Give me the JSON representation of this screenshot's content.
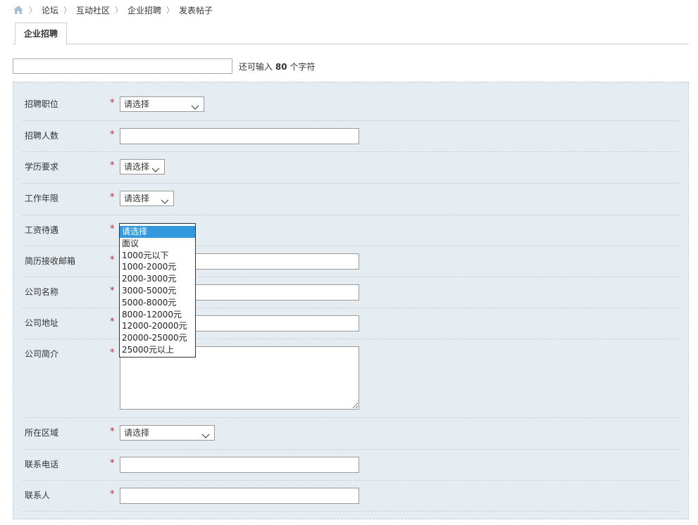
{
  "breadcrumb": {
    "items": [
      "论坛",
      "互动社区",
      "企业招聘",
      "发表帖子"
    ],
    "separator": "〉",
    "home_icon": "home-icon"
  },
  "tabs": [
    {
      "label": "企业招聘",
      "active": true
    }
  ],
  "title_field": {
    "value": "",
    "remain_prefix": "还可输入",
    "remain_count": "80",
    "remain_suffix": "个字符"
  },
  "form": {
    "required_mark": "*",
    "fields": {
      "position": {
        "label": "招聘职位",
        "type": "select",
        "value": "请选择"
      },
      "headcount": {
        "label": "招聘人数",
        "type": "text",
        "value": ""
      },
      "education": {
        "label": "学历要求",
        "type": "select",
        "value": "请选择"
      },
      "experience": {
        "label": "工作年限",
        "type": "select",
        "value": "请选择"
      },
      "salary": {
        "label": "工资待遇",
        "type": "select",
        "value": "请选择"
      },
      "email": {
        "label": "简历接收邮箱",
        "type": "text",
        "value": ""
      },
      "company_name": {
        "label": "公司名称",
        "type": "text",
        "value": ""
      },
      "company_address": {
        "label": "公司地址",
        "type": "text",
        "value": ""
      },
      "company_intro": {
        "label": "公司简介",
        "type": "textarea",
        "value": ""
      },
      "region": {
        "label": "所在区域",
        "type": "select",
        "value": "请选择"
      },
      "phone": {
        "label": "联系电话",
        "type": "text",
        "value": ""
      },
      "contact": {
        "label": "联系人",
        "type": "text",
        "value": ""
      }
    }
  },
  "salary_dropdown": {
    "open": true,
    "selected_index": 0,
    "options": [
      "请选择",
      "面议",
      "1000元以下",
      "1000-2000元",
      "2000-3000元",
      "3000-5000元",
      "5000-8000元",
      "8000-12000元",
      "12000-20000元",
      "20000-25000元",
      "25000元以上"
    ]
  },
  "colors": {
    "form_background": "#e5ecf2",
    "required": "#e02020",
    "selected_option": "#3399dd"
  }
}
